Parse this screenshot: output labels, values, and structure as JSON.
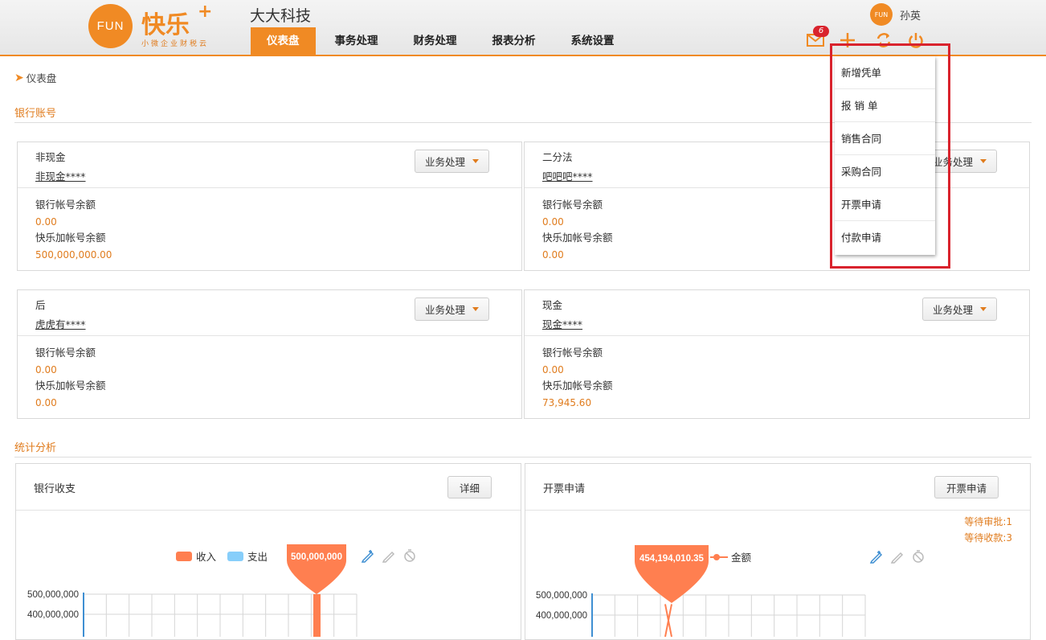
{
  "header": {
    "logo_circle_text": "FUN",
    "logo_text": "快乐",
    "logo_plus": "+",
    "logo_slogan": "小微企业财税云",
    "company": "大大科技",
    "nav": [
      {
        "label": "仪表盘",
        "active": true
      },
      {
        "label": "事务处理",
        "active": false
      },
      {
        "label": "财务处理",
        "active": false
      },
      {
        "label": "报表分析",
        "active": false
      },
      {
        "label": "系统设置",
        "active": false
      }
    ],
    "user_avatar_text": "FUN",
    "user_name": "孙英",
    "message_count": "6",
    "icons": [
      "mail-icon",
      "plus-icon",
      "refresh-icon",
      "power-icon"
    ]
  },
  "breadcrumb": {
    "current": "仪表盘"
  },
  "sections": {
    "bank": "银行账号",
    "stats": "统计分析"
  },
  "bank_cards": [
    {
      "name": "非现金",
      "account": "非现金****",
      "op_label": "业务处理",
      "balance_label": "银行帐号余额",
      "balance": "0.00",
      "kuaile_label": "快乐加帐号余额",
      "kuaile_balance": "500,000,000.00"
    },
    {
      "name": "二分法",
      "account": "吧吧吧****",
      "op_label": "业务处理",
      "balance_label": "银行帐号余额",
      "balance": "0.00",
      "kuaile_label": "快乐加帐号余额",
      "kuaile_balance": "0.00"
    },
    {
      "name": "后",
      "account": "虎虎有****",
      "op_label": "业务处理",
      "balance_label": "银行帐号余额",
      "balance": "0.00",
      "kuaile_label": "快乐加帐号余额",
      "kuaile_balance": "0.00"
    },
    {
      "name": "现金",
      "account": "现金****",
      "op_label": "业务处理",
      "balance_label": "银行帐号余额",
      "balance": "0.00",
      "kuaile_label": "快乐加帐号余额",
      "kuaile_balance": "73,945.60"
    }
  ],
  "stat_bank": {
    "title": "银行收支",
    "button": "详细",
    "legend": [
      {
        "name": "收入",
        "color": "#ff7f50"
      },
      {
        "name": "支出",
        "color": "#87cefa"
      }
    ],
    "tooltip": "500,000,000"
  },
  "stat_invoice": {
    "title": "开票申请",
    "button": "开票申请",
    "pending_approval": "等待审批:1",
    "pending_payment": "等待收款:3",
    "legend": [
      {
        "name": "金额",
        "color": "#ff7f50"
      }
    ],
    "tooltip": "454,194,010.35"
  },
  "chart_data": [
    {
      "type": "bar",
      "title": "银行收支",
      "series": [
        {
          "name": "收入",
          "values": [
            500000000
          ]
        },
        {
          "name": "支出",
          "values": []
        }
      ],
      "ytick_labels": [
        "500,000,000",
        "400,000,000"
      ],
      "ylim": [
        0,
        500000000
      ],
      "grid": true
    },
    {
      "type": "line",
      "title": "开票申请",
      "series": [
        {
          "name": "金额",
          "values": [
            454194010.35
          ]
        }
      ],
      "ytick_labels": [
        "500,000,000",
        "400,000,000"
      ],
      "ylim": [
        0,
        500000000
      ],
      "grid": true
    }
  ],
  "dropdown_menu": [
    "新增凭单",
    "报 销 单",
    "销售合同",
    "采购合同",
    "开票申请",
    "付款申请"
  ],
  "colors": {
    "accent": "#f08a24",
    "amount": "#e07c1e",
    "highlight_frame": "#d9232d",
    "chart_income": "#ff7f50",
    "chart_expense": "#87cefa"
  }
}
